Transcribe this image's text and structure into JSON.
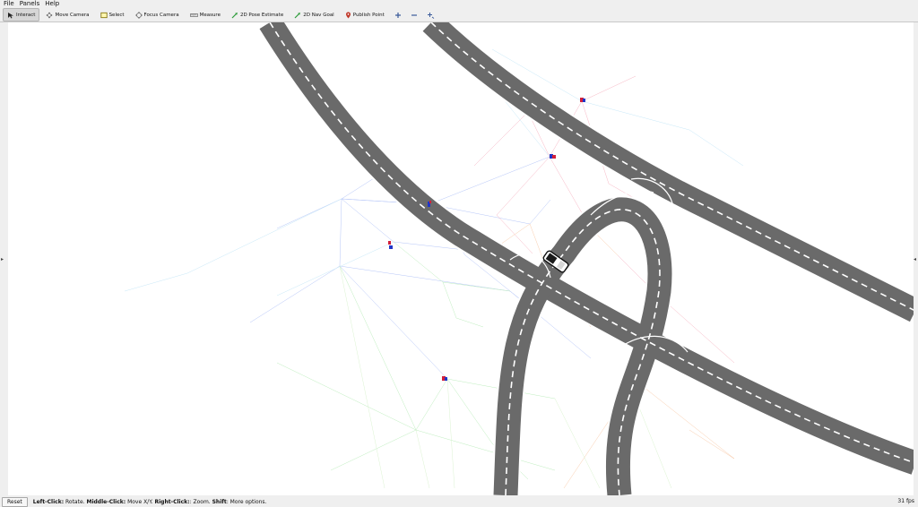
{
  "menu": {
    "file": "File",
    "panels": "Panels",
    "help": "Help"
  },
  "toolbar": {
    "interact": "Interact",
    "move_camera": "Move Camera",
    "select": "Select",
    "focus_camera": "Focus Camera",
    "measure": "Measure",
    "pose_estimate": "2D Pose Estimate",
    "nav_goal": "2D Nav Goal",
    "publish_point": "Publish Point",
    "extra_icons": [
      "plus-icon",
      "minus-icon",
      "crosshair-icon"
    ]
  },
  "status": {
    "reset": "Reset",
    "left_click_key": "Left-Click:",
    "left_click_text": " Rotate. ",
    "middle_click_key": "Middle-Click:",
    "middle_click_text": " Move X/Y. ",
    "right_click_key": "Right-Click:",
    "right_click_text": ": Zoom. ",
    "shift_key": "Shift",
    "shift_text": ": More options.",
    "fps": "31 fps"
  },
  "colors": {
    "road": "#676767",
    "road_edge": "#ffffff",
    "lane_marking": "#ffffff",
    "background": "#ffffff",
    "ui_panel": "#efefef",
    "nav_goal_icon": "#2e9c3a",
    "publish_point_icon": "#c0392b"
  }
}
